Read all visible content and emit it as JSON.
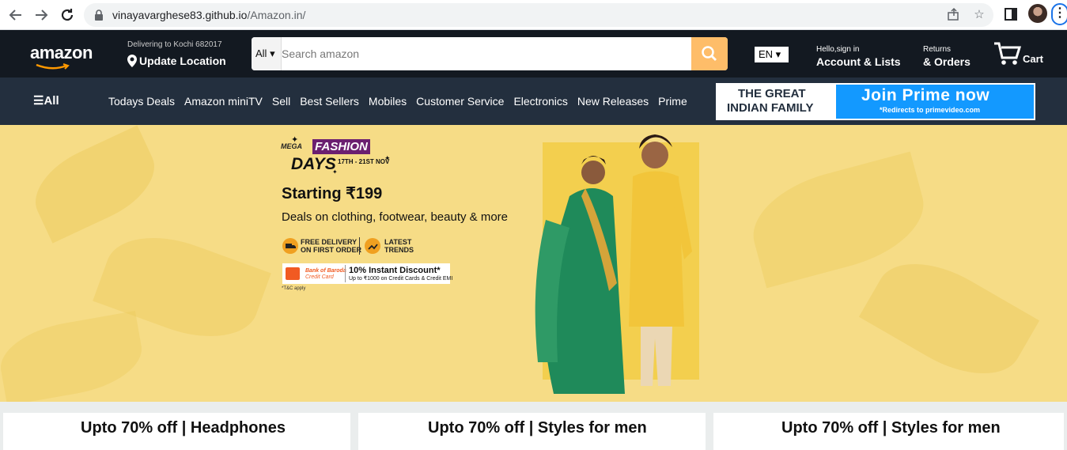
{
  "browser": {
    "back_icon": "arrow-left-icon",
    "forward_icon": "arrow-right-icon",
    "reload_icon": "reload-icon",
    "url_host": "vinayavarghese83.github.io",
    "url_path": "/Amazon.in/",
    "share_icon": "share-icon",
    "star_icon": "star-icon",
    "sidepanel_icon": "side-panel-icon",
    "menu_icon": "kebab-menu-icon"
  },
  "header": {
    "logo": "amazon",
    "deliver_line1": "Delivering to Kochi 682017",
    "deliver_line2": "Update Location",
    "search_category": "All",
    "search_placeholder": "Search amazon",
    "language": "EN",
    "account_line1": "Hello,sign in",
    "account_line2": "Account & Lists",
    "returns_line1": "Returns",
    "returns_line2": "& Orders",
    "cart_label": "Cart"
  },
  "subnav": {
    "all_label": "All",
    "links": [
      "Todays Deals",
      "Amazon miniTV",
      "Sell",
      "Best Sellers",
      "Mobiles",
      "Customer Service",
      "Electronics",
      "New Releases",
      "Prime"
    ],
    "prime_left_line1": "THE GREAT",
    "prime_left_line2": "INDIAN FAMILY",
    "prime_title": "Join Prime now",
    "prime_sub": "*Redirects to primevideo.com"
  },
  "hero": {
    "mega": "MEGA",
    "fashion": "FASHION",
    "days": "DAYS",
    "dates": "17TH - 21ST NOV",
    "starting": "Starting ₹199",
    "deals": "Deals on clothing, footwear, beauty & more",
    "feature1_line1": "FREE DELIVERY",
    "feature1_line2": "ON FIRST ORDER",
    "feature2_line1": "LATEST",
    "feature2_line2": "TRENDS",
    "bank_line1": "Bank of Baroda",
    "bank_line2": "Credit Card",
    "discount_line1": "10% Instant Discount*",
    "discount_line2": "Up to ₹1000 on Credit Cards & Credit EMI",
    "tc": "*T&C apply"
  },
  "cards": [
    {
      "title": "Upto 70% off | Headphones"
    },
    {
      "title": "Upto 70% off | Styles for men"
    },
    {
      "title": "Upto 70% off | Styles for men"
    }
  ],
  "colors": {
    "nav_main": "#131921",
    "nav_sub": "#232f3e",
    "search_button": "#febd69",
    "prime_blue": "#1399ff",
    "hero_bg": "#f6dc86"
  }
}
